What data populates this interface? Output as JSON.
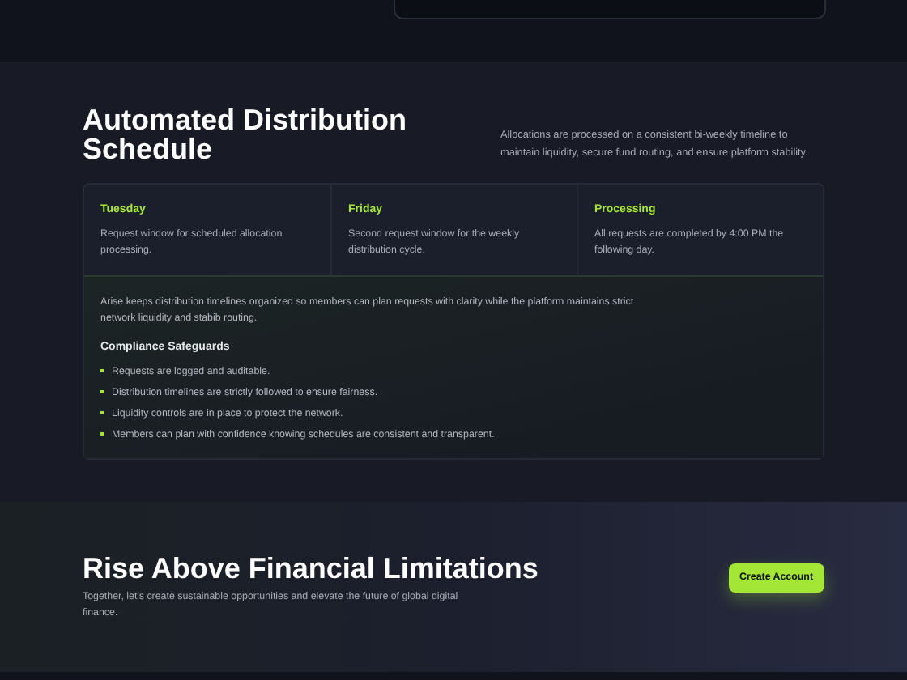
{
  "schedule": {
    "title": "Automated Distribution Schedule",
    "intro": "Allocations are processed on a consistent bi-weekly timeline to maintain liquidity, secure fund routing, and ensure platform stability.",
    "windows": [
      {
        "day": "Tuesday",
        "text": "Request window for scheduled allocation processing."
      },
      {
        "day": "Friday",
        "text": "Second request window for the weekly distribution cycle."
      },
      {
        "day": "Processing",
        "text": "All requests are completed by 4:00 PM the following day."
      }
    ],
    "summary": "Arise keeps distribution timelines organized so members can plan requests with clarity while the platform maintains strict network liquidity and stabib routing.",
    "safeguards_title": "Compliance Safeguards",
    "safeguards": [
      "Requests are logged and auditable.",
      "Distribution timelines are strictly followed to ensure fairness.",
      "Liquidity controls are in place to protect the network.",
      "Members can plan with confidence knowing schedules are consistent and transparent."
    ]
  },
  "cta": {
    "title": "Rise Above Financial Limitations",
    "text": "Together, let's create sustainable opportunities and elevate the future of global digital finance.",
    "button": "Create Account"
  }
}
